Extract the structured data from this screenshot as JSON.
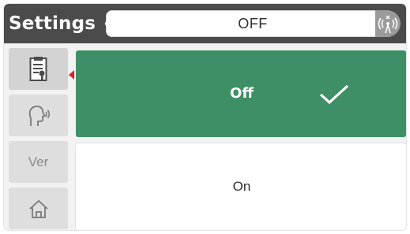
{
  "header": {
    "title": "Settings",
    "status_value": "OFF",
    "icons": [
      "back-bracket-icon",
      "forward-bracket-icon",
      "wireless-antenna-icon"
    ]
  },
  "sidebar": {
    "items": [
      {
        "name": "clipboard-settings",
        "icon": "clipboard-icon",
        "active": true
      },
      {
        "name": "voice-prompt",
        "icon": "speaking-head-icon",
        "active": false
      },
      {
        "name": "version",
        "label": "Ver",
        "active": false
      },
      {
        "name": "home",
        "icon": "home-icon",
        "active": false
      }
    ],
    "active_marker_color": "#d9232d"
  },
  "options": [
    {
      "label": "Off",
      "selected": true
    },
    {
      "label": "On",
      "selected": false
    }
  ],
  "colors": {
    "header_bg": "#4b4b4b",
    "selected_bg": "#3e8f65",
    "sidebar_bg": "#dedede",
    "antenna_bg": "#9a9a9a"
  }
}
